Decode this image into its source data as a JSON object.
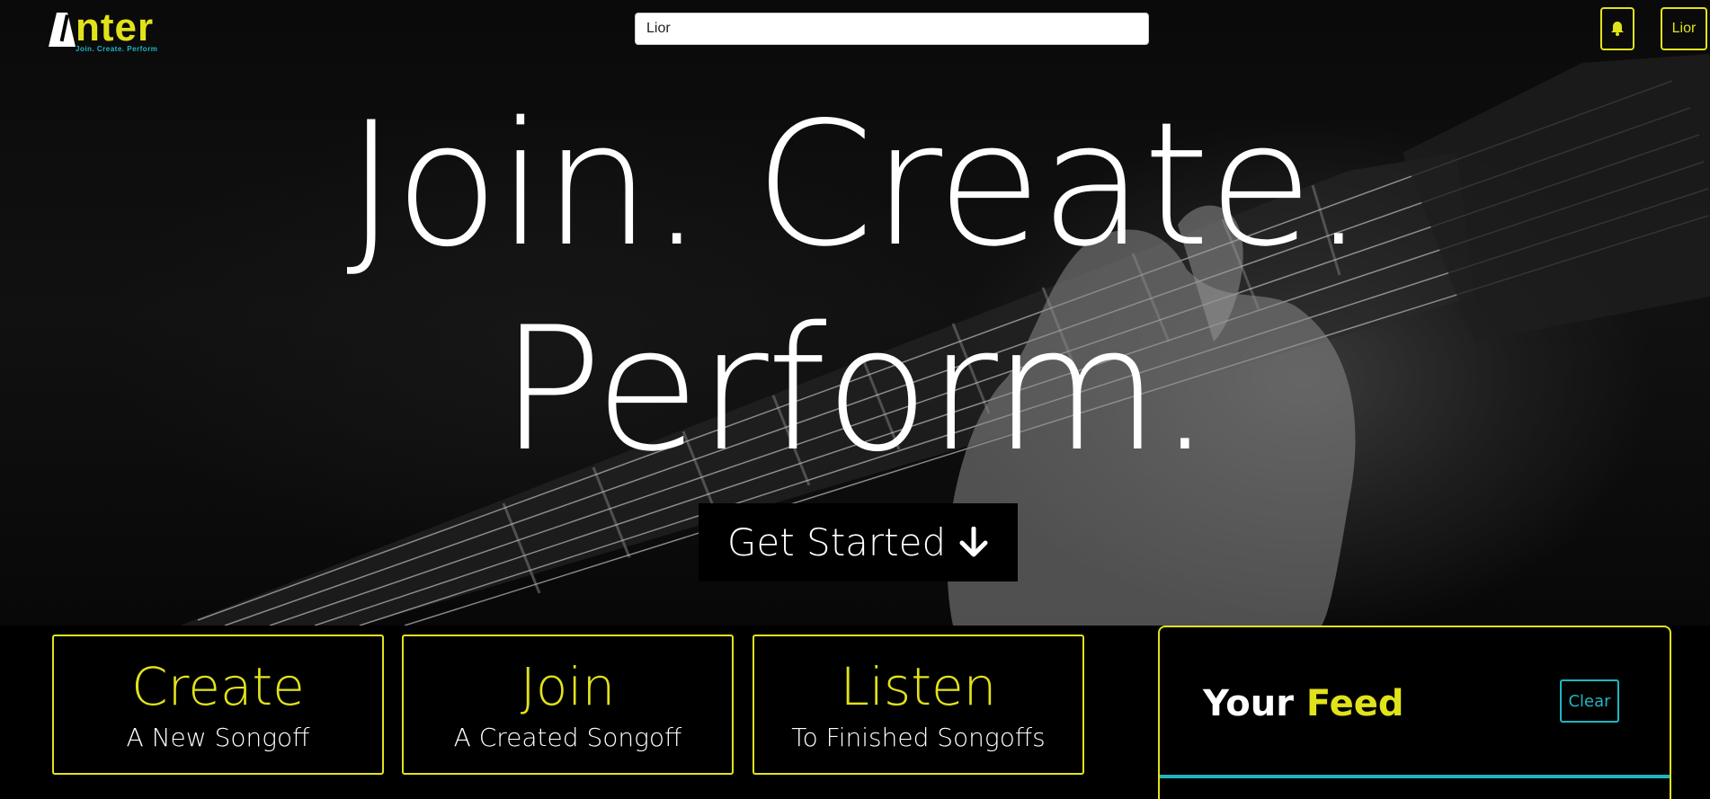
{
  "nav": {
    "logo_text": "nter",
    "logo_tagline": "Join. Create. Perform",
    "search_value": "Lior",
    "user_label": "Lior"
  },
  "hero": {
    "line1": "Join. Create.",
    "line2": "Perform.",
    "cta_label": "Get Started"
  },
  "cards": [
    {
      "title": "Create",
      "subtitle": "A New Songoff"
    },
    {
      "title": "Join",
      "subtitle": "A Created Songoff"
    },
    {
      "title": "Listen",
      "subtitle": "To Finished Songoffs"
    }
  ],
  "feed": {
    "title_prefix": "Your",
    "title_accent": "Feed",
    "clear_label": "Clear"
  },
  "colors": {
    "accent": "#e1e31a",
    "secondary": "#1fb6c1",
    "background": "#000000"
  },
  "icons": [
    "metronome-icon",
    "bell-icon",
    "arrow-down-icon"
  ]
}
